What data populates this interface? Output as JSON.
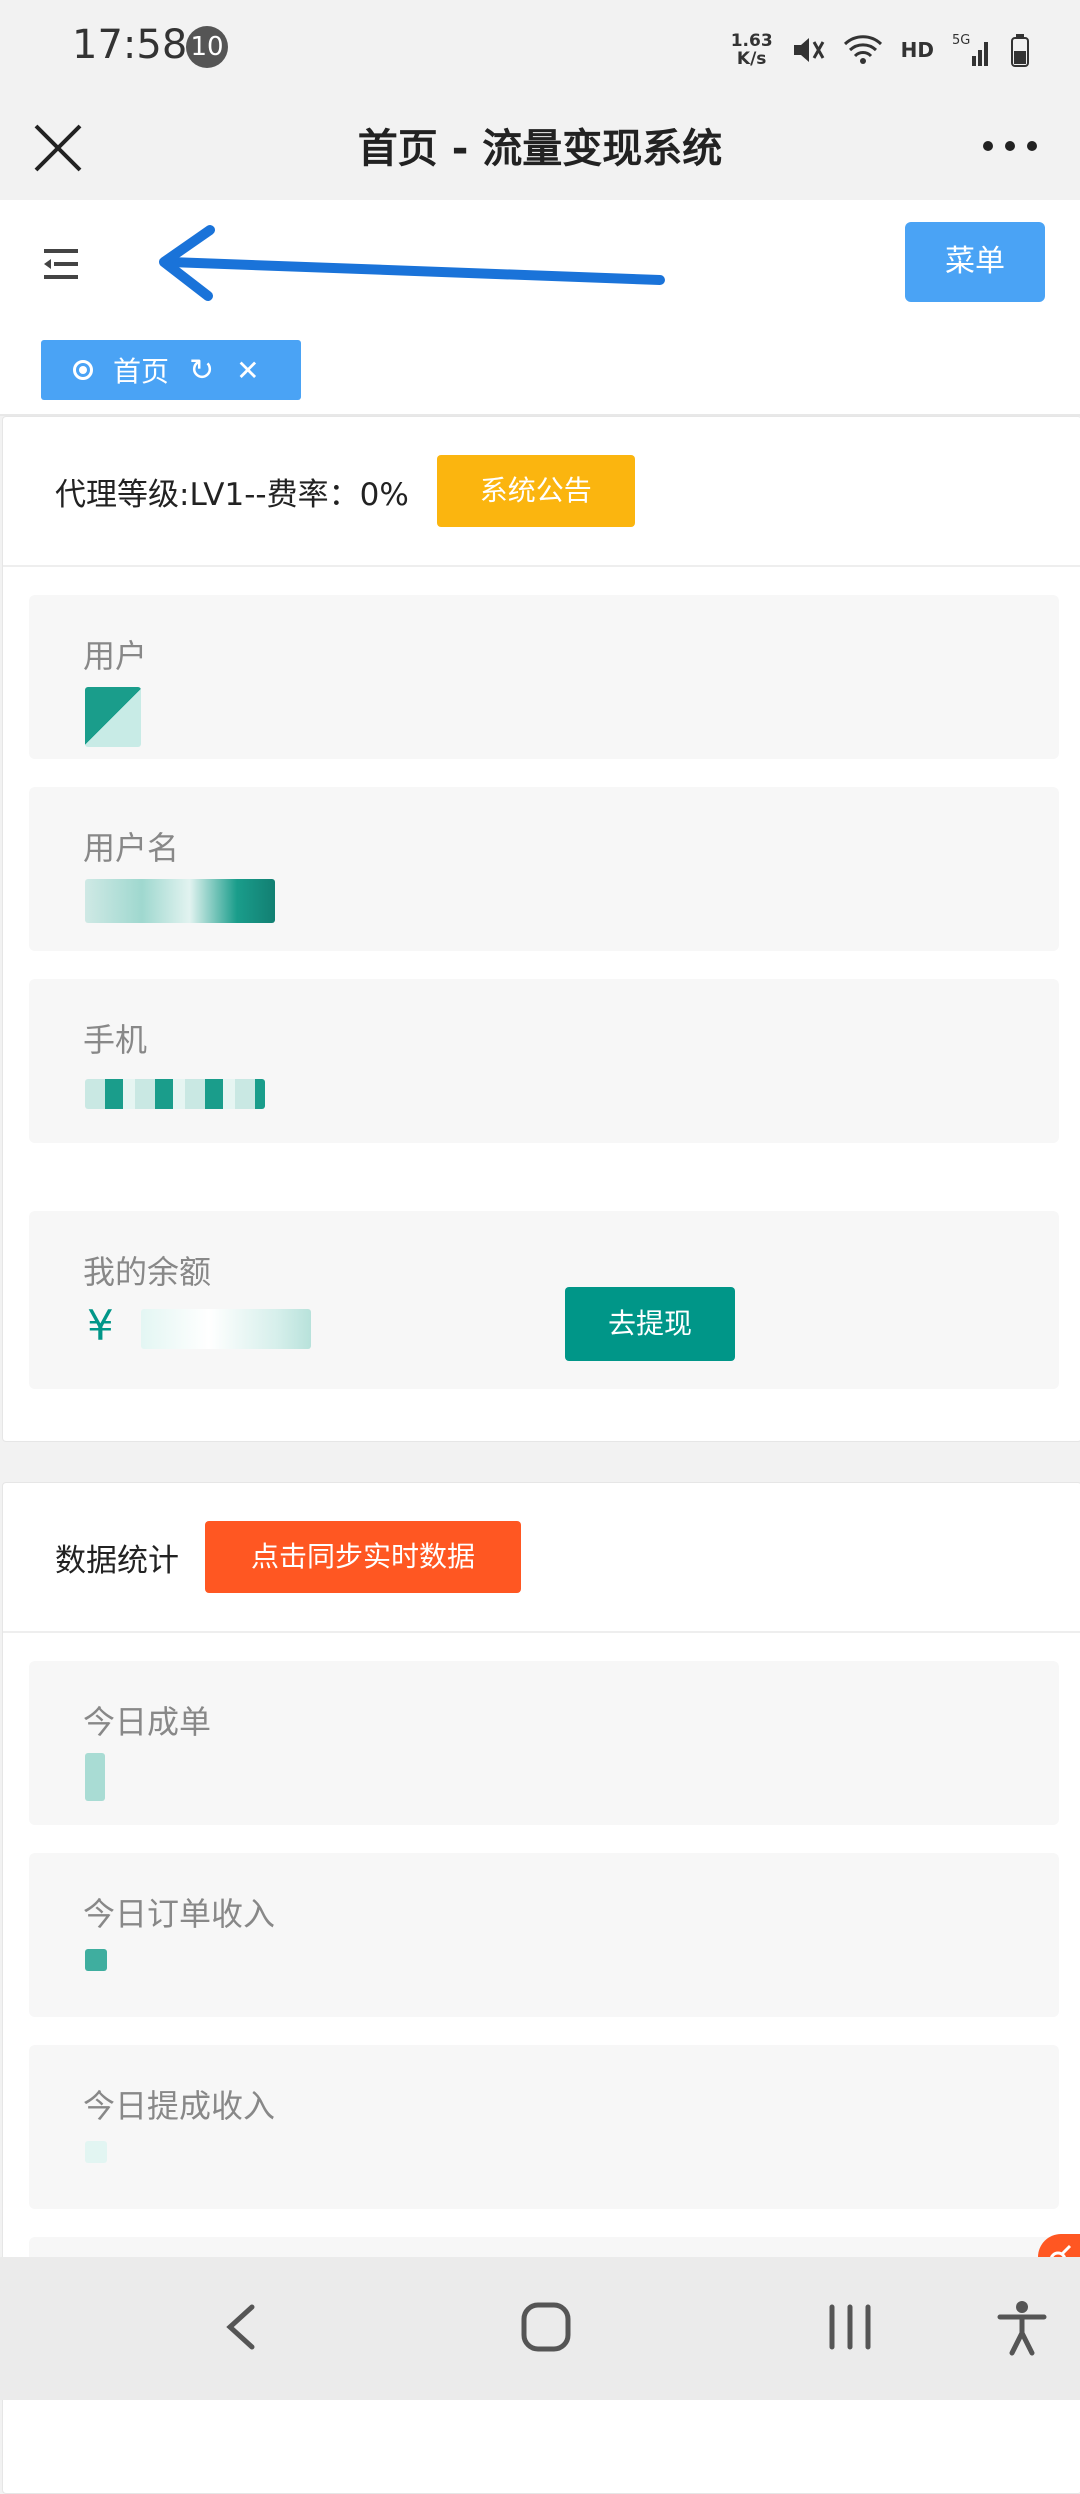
{
  "status_bar": {
    "time": "17:58",
    "notification_count": "10",
    "net_speed_value": "1.63",
    "net_speed_unit": "K/s",
    "hd": "HD",
    "network": "5G"
  },
  "title_bar": {
    "title": "首页 - 流量变现系统"
  },
  "toolbar": {
    "menu_label": "菜单"
  },
  "tab": {
    "label": "首页",
    "refresh": "↻",
    "close": "✕"
  },
  "agent_card": {
    "level_text": "代理等级:LV1--费率：0%",
    "notice_button": "系统公告",
    "fields": [
      {
        "label": "用户"
      },
      {
        "label": "用户名"
      },
      {
        "label": "手机"
      },
      {
        "label": "我的余额",
        "currency": "¥",
        "action": "去提现"
      }
    ]
  },
  "stats_card": {
    "title": "数据统计",
    "sync_button": "点击同步实时数据",
    "fields": [
      {
        "label": "今日成单"
      },
      {
        "label": "今日订单收入"
      },
      {
        "label": "今日提成收入"
      }
    ]
  },
  "colors": {
    "primary_blue": "#4aa3f5",
    "teal": "#009688",
    "orange": "#ff5722",
    "yellow": "#fbb50f"
  }
}
